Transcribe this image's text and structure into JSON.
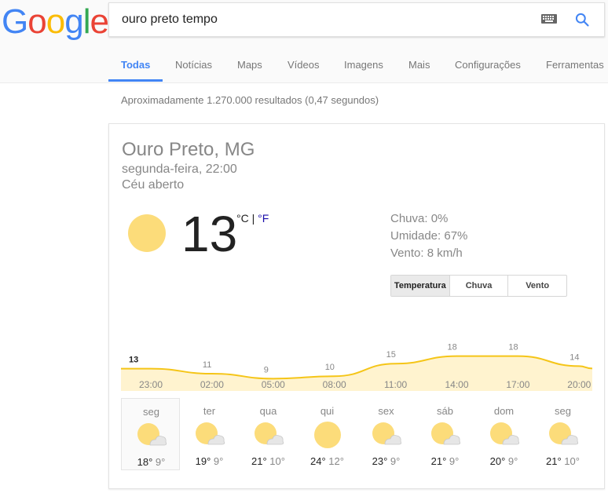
{
  "logo": {
    "text": "Google"
  },
  "search": {
    "query": "ouro preto tempo"
  },
  "tabs": [
    {
      "label": "Todas",
      "active": true
    },
    {
      "label": "Notícias"
    },
    {
      "label": "Maps"
    },
    {
      "label": "Vídeos"
    },
    {
      "label": "Imagens"
    },
    {
      "label": "Mais"
    },
    {
      "label": "Configurações"
    },
    {
      "label": "Ferramentas"
    }
  ],
  "result_stats": "Aproximadamente 1.270.000 resultados (0,47 segundos)",
  "weather": {
    "location": "Ouro Preto, MG",
    "datetime": "segunda-feira, 22:00",
    "condition": "Céu aberto",
    "temperature": "13",
    "unit_c": "°C",
    "unit_sep": " | ",
    "unit_f": "°F",
    "details": {
      "chuva": "Chuva: 0%",
      "umidade": "Umidade: 67%",
      "vento": "Vento: 8 km/h"
    },
    "segments": [
      "Temperatura",
      "Chuva",
      "Vento"
    ],
    "chart_data": {
      "type": "area",
      "x": [
        "23:00",
        "02:00",
        "05:00",
        "08:00",
        "11:00",
        "14:00",
        "17:00",
        "20:00"
      ],
      "labels": [
        {
          "t": 0,
          "v": 13
        },
        {
          "t": 1,
          "v": 11
        },
        {
          "t": 2,
          "v": 9
        },
        {
          "t": 3,
          "v": 10
        },
        {
          "t": 4,
          "v": 15
        },
        {
          "t": 5,
          "v": 18
        },
        {
          "t": 6,
          "v": 18
        },
        {
          "t": 7,
          "v": 14
        }
      ],
      "colors": {
        "line": "#f5c518",
        "fill": "#fff3cf"
      }
    },
    "forecast": [
      {
        "day": "seg",
        "high": "18°",
        "low": "9°",
        "icon": "partly-cloudy-icon",
        "active": true
      },
      {
        "day": "ter",
        "high": "19°",
        "low": "9°",
        "icon": "partly-cloudy-icon"
      },
      {
        "day": "qua",
        "high": "21°",
        "low": "10°",
        "icon": "partly-cloudy-icon"
      },
      {
        "day": "qui",
        "high": "24°",
        "low": "12°",
        "icon": "sun-icon"
      },
      {
        "day": "sex",
        "high": "23°",
        "low": "9°",
        "icon": "partly-cloudy-icon"
      },
      {
        "day": "sáb",
        "high": "21°",
        "low": "9°",
        "icon": "partly-cloudy-icon"
      },
      {
        "day": "dom",
        "high": "20°",
        "low": "9°",
        "icon": "partly-cloudy-icon"
      },
      {
        "day": "seg",
        "high": "21°",
        "low": "10°",
        "icon": "partly-cloudy-icon"
      }
    ]
  },
  "colors": {
    "blue": "#4285f4",
    "red": "#ea4335",
    "yellow": "#fbbc05",
    "green": "#34a853",
    "sun": "#fcdc7a"
  }
}
